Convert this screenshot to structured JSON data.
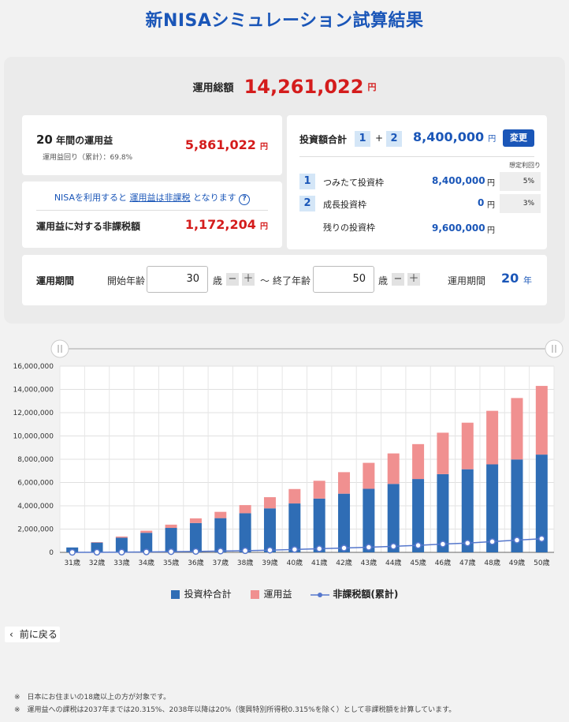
{
  "title": "新NISAシミュレーション試算結果",
  "summary": {
    "total_label": "運用総額",
    "total_value": "14,261,022",
    "yen": "円",
    "profit_years": "20",
    "profit_label": "年間の運用益",
    "profit_rate": "運用益回り（累計）：69.8%",
    "profit_value": "5,861,022",
    "nisa_text_1": "NISAを利用すると",
    "nisa_link": "運用益は非課税",
    "nisa_text_2": "となります",
    "help_icon": "?",
    "taxfree_label": "運用益に対する非課税額",
    "taxfree_value": "1,172,204"
  },
  "investment": {
    "label": "投資額合計",
    "num1": "1",
    "plus": "+",
    "num2": "2",
    "total": "8,400,000",
    "change_button": "変更",
    "rate_header": "想定利回り",
    "rows": [
      {
        "num": "1",
        "name": "つみたて投資枠",
        "amount": "8,400,000",
        "rate": "5%"
      },
      {
        "num": "2",
        "name": "成長投資枠",
        "amount": "0",
        "rate": "3%"
      }
    ],
    "remaining_label": "残りの投資枠",
    "remaining_value": "9,600,000"
  },
  "period": {
    "label": "運用期間",
    "start_label": "開始年齢",
    "start_value": "30",
    "age_unit": "歳",
    "minus": "−",
    "plus": "＋",
    "tilde": "〜",
    "end_label": "終了年齢",
    "end_value": "50",
    "span_label": "運用期間",
    "span_value": "20",
    "span_unit": "年"
  },
  "chart_data": {
    "type": "bar",
    "categories": [
      "31歳",
      "32歳",
      "33歳",
      "34歳",
      "35歳",
      "36歳",
      "37歳",
      "38歳",
      "39歳",
      "40歳",
      "41歳",
      "42歳",
      "43歳",
      "44歳",
      "45歳",
      "46歳",
      "47歳",
      "48歳",
      "49歳",
      "50歳"
    ],
    "series": [
      {
        "name": "投資枠合計",
        "type": "bar",
        "color": "#2f6db5",
        "values": [
          420000,
          840000,
          1260000,
          1680000,
          2100000,
          2520000,
          2940000,
          3360000,
          3780000,
          4200000,
          4620000,
          5040000,
          5460000,
          5880000,
          6300000,
          6720000,
          7140000,
          7560000,
          7980000,
          8400000
        ]
      },
      {
        "name": "運用益",
        "type": "bar",
        "color": "#f09090",
        "values": [
          0,
          40000,
          100000,
          180000,
          280000,
          400000,
          540000,
          700000,
          960000,
          1240000,
          1530000,
          1850000,
          2230000,
          2620000,
          3000000,
          3560000,
          4000000,
          4600000,
          5280000,
          5900000
        ]
      },
      {
        "name": "非課税額(累計)",
        "type": "line",
        "color": "#5577cc",
        "values": [
          0,
          10000,
          20000,
          36000,
          56000,
          80000,
          108000,
          140000,
          190000,
          250000,
          310000,
          370000,
          440000,
          520000,
          600000,
          710000,
          800000,
          920000,
          1050000,
          1172204
        ]
      }
    ],
    "yticks": [
      "0",
      "2,000,000",
      "4,000,000",
      "6,000,000",
      "8,000,000",
      "10,000,000",
      "12,000,000",
      "14,000,000",
      "16,000,000"
    ],
    "ylim": [
      0,
      16000000
    ]
  },
  "legend": {
    "invest": "投資枠合計",
    "profit": "運用益",
    "taxfree": "非課税額(累計)"
  },
  "back_label": "前に戻る",
  "notes": [
    "※　日本にお住まいの18歳以上の方が対象です。",
    "※　運用益への課税は2037年までは20.315%、2038年以降は20%（復興特別所得税0.315%を除く）として非課税額を計算しています。"
  ]
}
